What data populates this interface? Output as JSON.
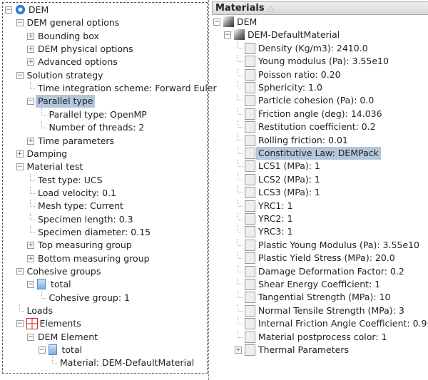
{
  "left_tree": [
    {
      "level": 0,
      "label": "DEM",
      "exp": "minus",
      "icon": "gear"
    },
    {
      "level": 1,
      "label": "DEM general options",
      "exp": "minus"
    },
    {
      "level": 2,
      "label": "Bounding box",
      "exp": "plus"
    },
    {
      "level": 2,
      "label": "DEM physical options",
      "exp": "plus"
    },
    {
      "level": 2,
      "label": "Advanced options",
      "exp": "plus"
    },
    {
      "level": 1,
      "label": "Solution strategy",
      "exp": "minus"
    },
    {
      "level": 2,
      "label": "Time integration scheme: Forward Euler"
    },
    {
      "level": 2,
      "label": "Parallel type",
      "exp": "minus",
      "selected": true
    },
    {
      "level": 3,
      "label": "Parallel type: OpenMP"
    },
    {
      "level": 3,
      "label": "Number of threads: 2"
    },
    {
      "level": 2,
      "label": "Time parameters",
      "exp": "plus"
    },
    {
      "level": 1,
      "label": "Damping",
      "exp": "plus"
    },
    {
      "level": 1,
      "label": "Material test",
      "exp": "minus"
    },
    {
      "level": 2,
      "label": "Test type: UCS"
    },
    {
      "level": 2,
      "label": "Load velocity: 0.1"
    },
    {
      "level": 2,
      "label": "Mesh type: Current"
    },
    {
      "level": 2,
      "label": "Specimen length: 0.3"
    },
    {
      "level": 2,
      "label": "Specimen diameter: 0.15"
    },
    {
      "level": 2,
      "label": "Top measuring group",
      "exp": "plus"
    },
    {
      "level": 2,
      "label": "Bottom measuring group",
      "exp": "plus"
    },
    {
      "level": 1,
      "label": "Cohesive groups",
      "exp": "minus"
    },
    {
      "level": 2,
      "label": "total",
      "exp": "minus",
      "icon": "doc"
    },
    {
      "level": 3,
      "label": "Cohesive group: 1"
    },
    {
      "level": 1,
      "label": "Loads"
    },
    {
      "level": 1,
      "label": "Elements",
      "exp": "minus",
      "icon": "grid"
    },
    {
      "level": 2,
      "label": "DEM Element",
      "exp": "minus"
    },
    {
      "level": 3,
      "label": "total",
      "exp": "minus",
      "icon": "doc"
    },
    {
      "level": 4,
      "label": "Material: DEM-DefaultMaterial"
    }
  ],
  "right_header": {
    "title": "Materials",
    "sort_icon": "△"
  },
  "right_tree": [
    {
      "level": 0,
      "label": "DEM",
      "exp": "minus",
      "icon": "mat"
    },
    {
      "level": 1,
      "label": "DEM-DefaultMaterial",
      "exp": "minus",
      "icon": "mat"
    },
    {
      "level": 2,
      "label": "Density (Kg/m3): 2410.0",
      "icon": "box"
    },
    {
      "level": 2,
      "label": "Young modulus (Pa): 3.55e10",
      "icon": "box"
    },
    {
      "level": 2,
      "label": "Poisson ratio: 0.20",
      "icon": "box"
    },
    {
      "level": 2,
      "label": "Sphericity: 1.0",
      "icon": "box"
    },
    {
      "level": 2,
      "label": "Particle cohesion (Pa): 0.0",
      "icon": "box"
    },
    {
      "level": 2,
      "label": "Friction angle (deg): 14.036",
      "icon": "box"
    },
    {
      "level": 2,
      "label": "Restitution coefficient: 0.2",
      "icon": "box"
    },
    {
      "level": 2,
      "label": "Rolling friction: 0.01",
      "icon": "box"
    },
    {
      "level": 2,
      "label": "Constitutive Law: DEMPack",
      "icon": "box",
      "selected": true
    },
    {
      "level": 2,
      "label": "LCS1 (MPa): 1",
      "icon": "box"
    },
    {
      "level": 2,
      "label": "LCS2 (MPa): 1",
      "icon": "box"
    },
    {
      "level": 2,
      "label": "LCS3 (MPa): 1",
      "icon": "box"
    },
    {
      "level": 2,
      "label": "YRC1: 1",
      "icon": "box"
    },
    {
      "level": 2,
      "label": "YRC2: 1",
      "icon": "box"
    },
    {
      "level": 2,
      "label": "YRC3: 1",
      "icon": "box"
    },
    {
      "level": 2,
      "label": "Plastic Young Modulus (Pa): 3.55e10",
      "icon": "box"
    },
    {
      "level": 2,
      "label": "Plastic Yield Stress (MPa): 20.0",
      "icon": "box"
    },
    {
      "level": 2,
      "label": "Damage Deformation Factor: 0.2",
      "icon": "box"
    },
    {
      "level": 2,
      "label": "Shear Energy Coefficient: 1",
      "icon": "box"
    },
    {
      "level": 2,
      "label": "Tangential Strength (MPa): 10",
      "icon": "box"
    },
    {
      "level": 2,
      "label": "Normal Tensile Strength (MPa): 3",
      "icon": "box"
    },
    {
      "level": 2,
      "label": "Internal Friction Angle Coefficient: 0.9",
      "icon": "box"
    },
    {
      "level": 2,
      "label": "Material postprocess color: 1",
      "icon": "box"
    },
    {
      "level": 2,
      "label": "Thermal Parameters",
      "exp": "plus",
      "icon": "box"
    }
  ]
}
